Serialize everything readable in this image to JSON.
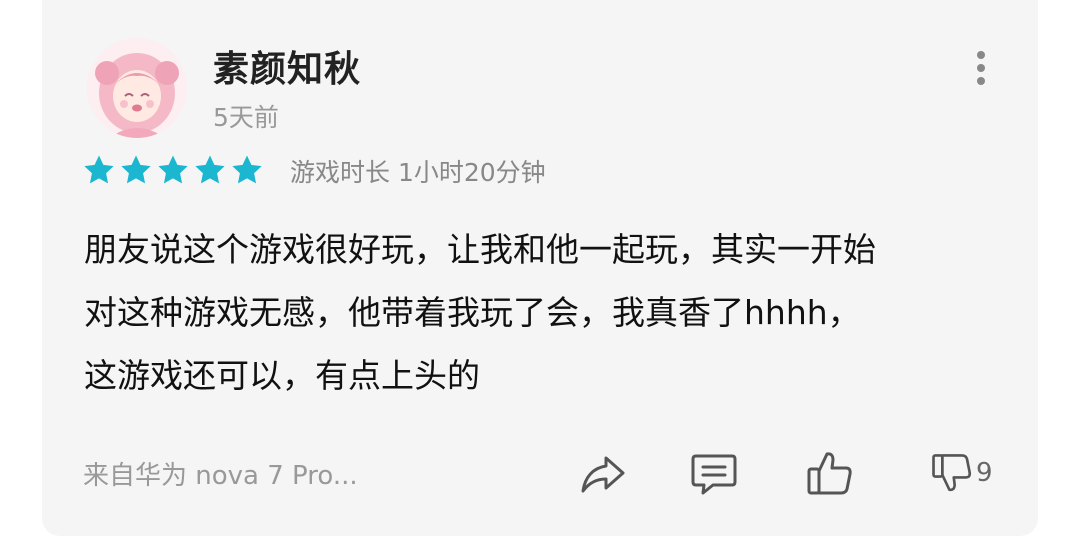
{
  "review": {
    "username": "素颜知秋",
    "time_ago": "5天前",
    "rating": 5,
    "playtime": "游戏时长 1小时20分钟",
    "content_lines": [
      "朋友说这个游戏很好玩，让我和他一起玩，其实一开始",
      "对这种游戏无感，他带着我玩了会，我真香了hhhh，",
      "这游戏还可以，有点上头的"
    ],
    "device": "来自华为 nova 7 Pro...",
    "dislike_count": "9"
  },
  "colors": {
    "star": "#1bb6d0",
    "icon": "#555555",
    "card_bg": "#f5f5f5"
  },
  "icons": {
    "avatar": "anime-girl-avatar",
    "more": "vertical-ellipsis-icon",
    "share": "share-arrow-icon",
    "comment": "comment-bubble-icon",
    "like": "thumbs-up-icon",
    "dislike": "thumbs-down-icon"
  }
}
